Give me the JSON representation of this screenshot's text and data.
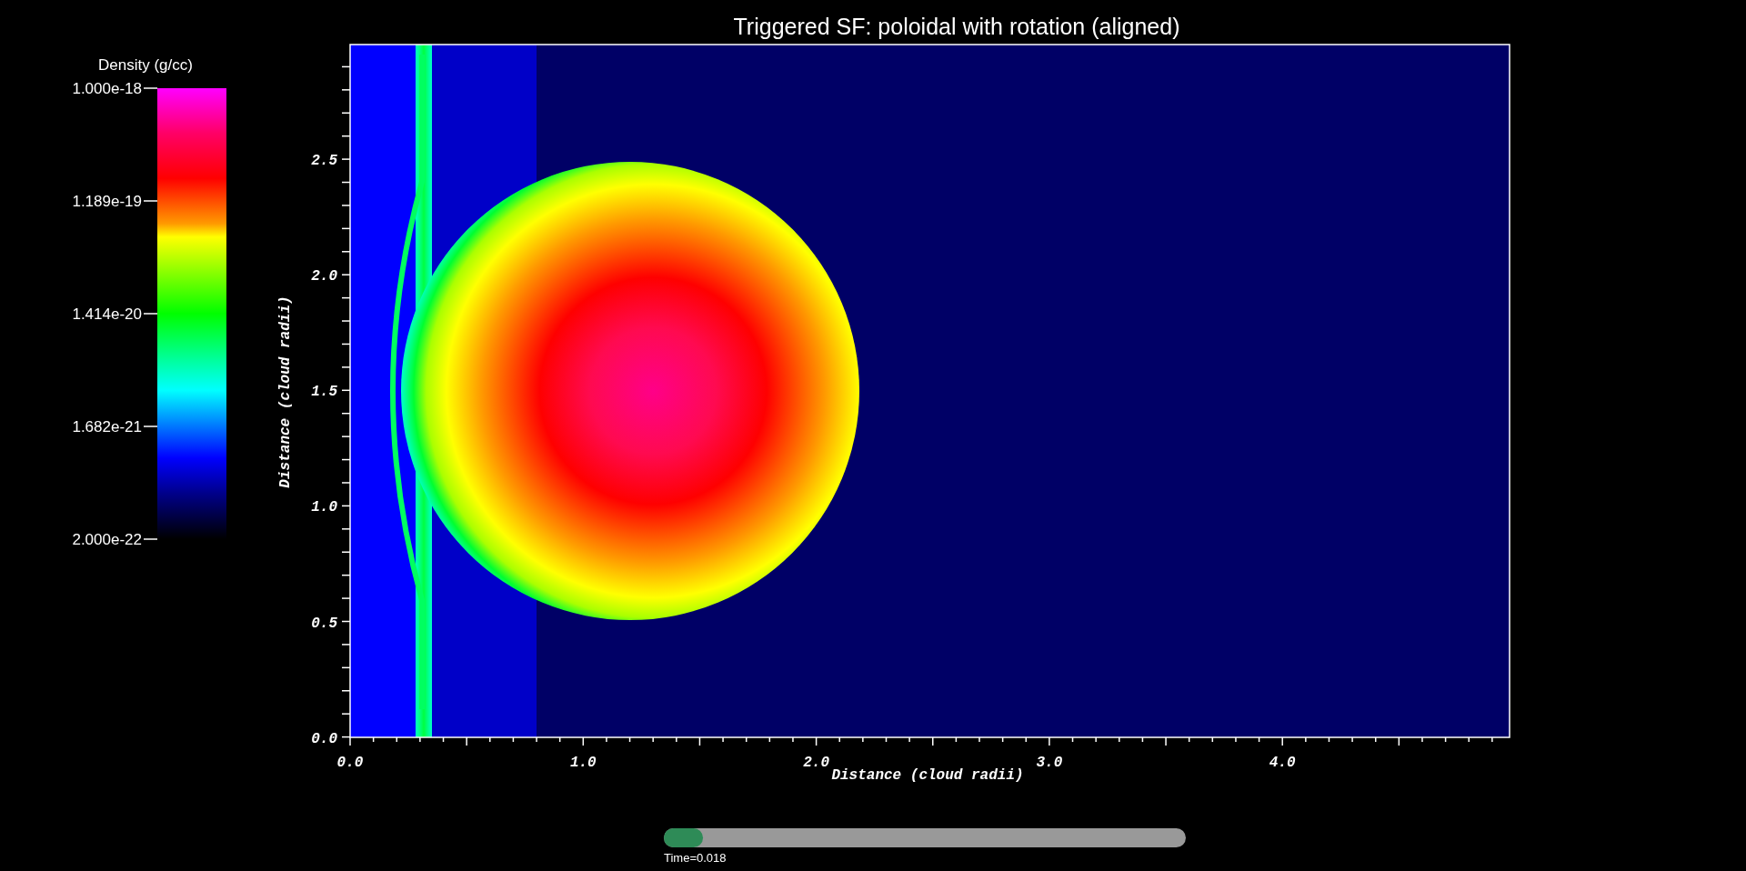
{
  "plot_title": "Triggered SF: poloidal with rotation (aligned)",
  "legend": {
    "title": "Density (g/cc)",
    "labels": [
      "1.000e-18",
      "1.189e-19",
      "1.414e-20",
      "1.682e-21",
      "2.000e-22"
    ]
  },
  "plot": {
    "xlabel": "Distance (cloud radii)",
    "ylabel": "Distance (cloud radii)",
    "xticks": [
      "0.0",
      "1.0",
      "2.0",
      "3.0",
      "4.0"
    ],
    "yticks": [
      "2.5",
      "2.0",
      "1.5",
      "1.0",
      "0.5",
      "0.0"
    ]
  },
  "time_slider": {
    "level": 0.075,
    "label": "Time=0.018"
  }
}
